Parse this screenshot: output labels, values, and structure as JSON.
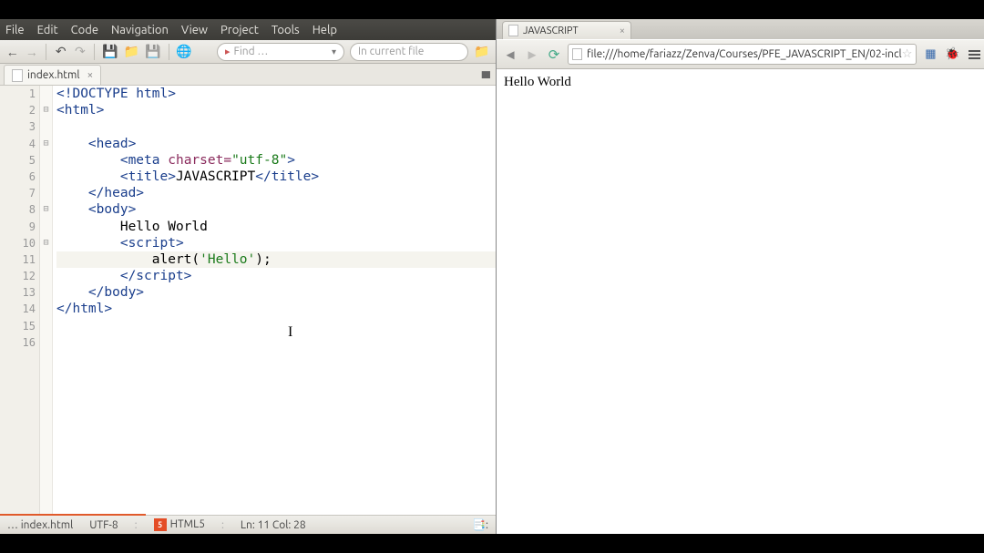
{
  "ide": {
    "menubar": [
      "File",
      "Edit",
      "Code",
      "Navigation",
      "View",
      "Project",
      "Tools",
      "Help"
    ],
    "toolbar": {
      "find_placeholder": "Find …",
      "scope_placeholder": "In current file"
    },
    "tab": {
      "filename": "index.html"
    },
    "code": {
      "lines": [
        {
          "n": 1,
          "fold": "",
          "segs": [
            [
              "<!DOCTYPE html>",
              "t-tag"
            ]
          ]
        },
        {
          "n": 2,
          "fold": "⊟",
          "segs": [
            [
              "<html>",
              "t-tag"
            ]
          ]
        },
        {
          "n": 3,
          "fold": "",
          "segs": [
            [
              "",
              "t-txt"
            ]
          ]
        },
        {
          "n": 4,
          "fold": "⊟",
          "segs": [
            [
              "    ",
              "t-txt"
            ],
            [
              "<head>",
              "t-tag"
            ]
          ]
        },
        {
          "n": 5,
          "fold": "",
          "segs": [
            [
              "        ",
              "t-txt"
            ],
            [
              "<meta ",
              "t-tag"
            ],
            [
              "charset=",
              "t-attr"
            ],
            [
              "\"utf-8\"",
              "t-str"
            ],
            [
              ">",
              "t-tag"
            ]
          ]
        },
        {
          "n": 6,
          "fold": "",
          "segs": [
            [
              "        ",
              "t-txt"
            ],
            [
              "<title>",
              "t-tag"
            ],
            [
              "JAVASCRIPT",
              "t-txt"
            ],
            [
              "</title>",
              "t-tag"
            ]
          ]
        },
        {
          "n": 7,
          "fold": "",
          "segs": [
            [
              "    ",
              "t-txt"
            ],
            [
              "</head>",
              "t-tag"
            ]
          ]
        },
        {
          "n": 8,
          "fold": "⊟",
          "segs": [
            [
              "    ",
              "t-txt"
            ],
            [
              "<body>",
              "t-tag"
            ]
          ]
        },
        {
          "n": 9,
          "fold": "",
          "segs": [
            [
              "        Hello World",
              "t-txt"
            ]
          ]
        },
        {
          "n": 10,
          "fold": "⊟",
          "segs": [
            [
              "        ",
              "t-txt"
            ],
            [
              "<script>",
              "t-tag"
            ]
          ]
        },
        {
          "n": 11,
          "fold": "",
          "hl": true,
          "segs": [
            [
              "            alert(",
              "t-txt"
            ],
            [
              "'Hello'",
              "t-jsstr"
            ],
            [
              ");",
              "t-txt"
            ]
          ]
        },
        {
          "n": 12,
          "fold": "",
          "segs": [
            [
              "        ",
              "t-txt"
            ],
            [
              "</script>",
              "t-tag"
            ]
          ]
        },
        {
          "n": 13,
          "fold": "",
          "segs": [
            [
              "    ",
              "t-txt"
            ],
            [
              "</body>",
              "t-tag"
            ]
          ]
        },
        {
          "n": 14,
          "fold": "",
          "segs": [
            [
              "</html>",
              "t-tag"
            ]
          ]
        },
        {
          "n": 15,
          "fold": "",
          "segs": [
            [
              "",
              "t-txt"
            ]
          ]
        },
        {
          "n": 16,
          "fold": "",
          "segs": [
            [
              "",
              "t-txt"
            ]
          ]
        }
      ]
    },
    "status": {
      "path": "… index.html",
      "encoding": "UTF-8",
      "doctype": "HTML5",
      "position": "Ln: 11 Col: 28"
    }
  },
  "browser": {
    "tab_title": "JAVASCRIPT",
    "url": "file:///home/fariazz/Zenva/Courses/PFE_JAVASCRIPT_EN/02-incl",
    "page_text": "Hello World"
  }
}
